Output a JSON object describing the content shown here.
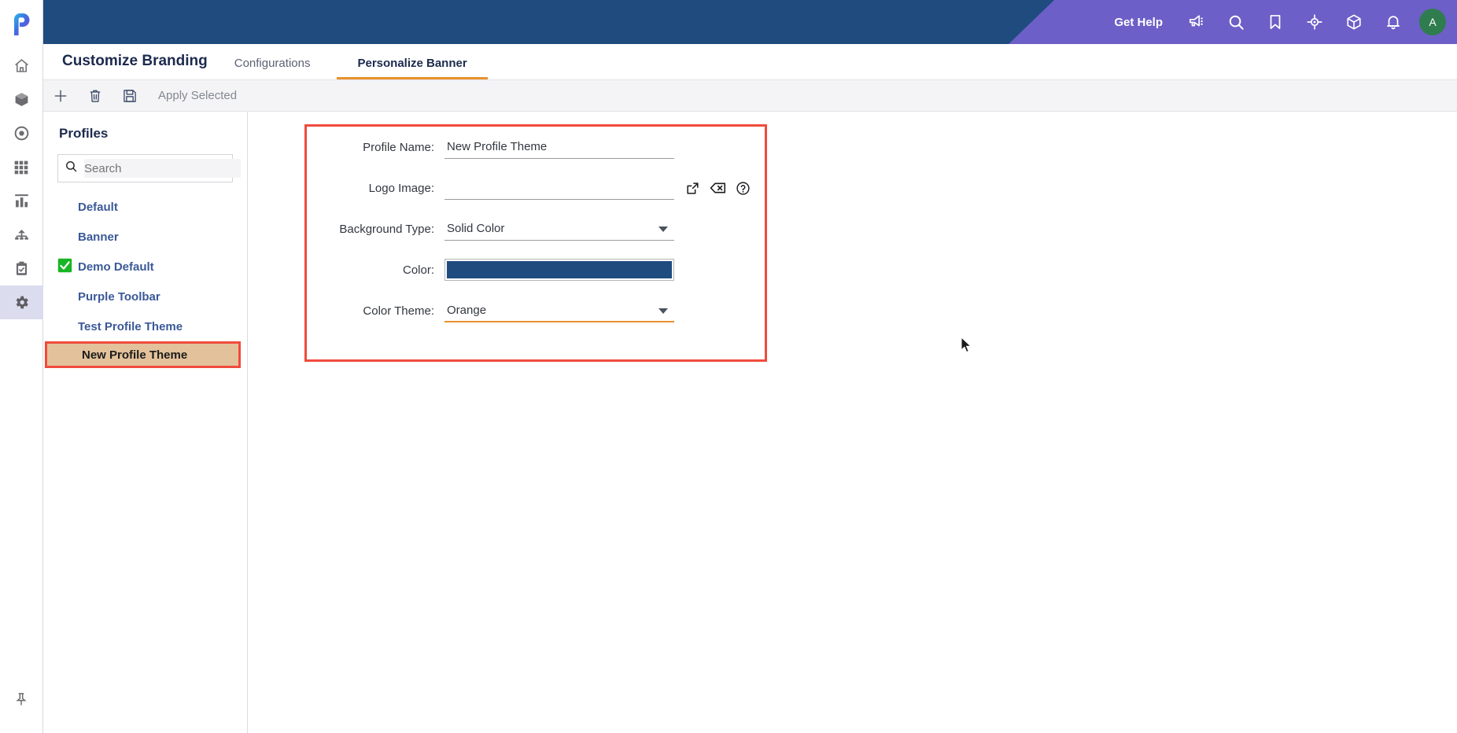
{
  "app": {
    "logo_icon": "p-logo-icon"
  },
  "rail": {
    "items": [
      {
        "icon": "home-icon",
        "name": "home",
        "active": false
      },
      {
        "icon": "cube-icon",
        "name": "assets",
        "active": false
      },
      {
        "icon": "target-icon",
        "name": "targets",
        "active": false
      },
      {
        "icon": "grid-icon",
        "name": "apps",
        "active": false
      },
      {
        "icon": "bar-chart-icon",
        "name": "reports",
        "active": false
      },
      {
        "icon": "hierarchy-icon",
        "name": "hierarchy",
        "active": false
      },
      {
        "icon": "clipboard-check-icon",
        "name": "tasks",
        "active": false
      },
      {
        "icon": "gear-icon",
        "name": "settings",
        "active": true
      }
    ],
    "pin": {
      "icon": "pushpin-icon",
      "name": "pin-sidebar"
    }
  },
  "header": {
    "get_help_label": "Get Help",
    "icons": [
      {
        "icon": "megaphone-icon",
        "name": "announcements"
      },
      {
        "icon": "search-icon",
        "name": "global-search"
      },
      {
        "icon": "bookmark-icon",
        "name": "bookmarks"
      },
      {
        "icon": "compass-icon",
        "name": "navigator"
      },
      {
        "icon": "package-icon",
        "name": "packages"
      },
      {
        "icon": "bell-icon",
        "name": "notifications"
      }
    ],
    "avatar_initial": "A",
    "avatar_color": "#2f7d4f",
    "banner_color": "#1f4b7f",
    "accent_color": "#6c5fc7"
  },
  "titlebar": {
    "title": "Customize Branding",
    "tabs": [
      {
        "label": "Configurations",
        "active": false
      },
      {
        "label": "Personalize Banner",
        "active": true
      }
    ],
    "active_tab_underline": "#e8912d"
  },
  "toolbar": {
    "buttons": [
      {
        "icon": "plus-icon",
        "name": "add-profile"
      },
      {
        "icon": "trash-icon",
        "name": "delete-profile"
      },
      {
        "icon": "save-icon",
        "name": "save-profile"
      }
    ],
    "apply_selected_label": "Apply Selected"
  },
  "profiles": {
    "title": "Profiles",
    "search": {
      "placeholder": "Search",
      "value": "",
      "icon": "search-icon"
    },
    "items": [
      {
        "label": "Default",
        "checked": false,
        "selected": false
      },
      {
        "label": "Banner",
        "checked": false,
        "selected": false
      },
      {
        "label": "Demo Default",
        "checked": true,
        "selected": false
      },
      {
        "label": "Purple Toolbar",
        "checked": false,
        "selected": false
      },
      {
        "label": "Test Profile Theme",
        "checked": false,
        "selected": false
      },
      {
        "label": "New Profile Theme",
        "checked": false,
        "selected": true
      }
    ],
    "checked_color": "#18b524",
    "selected_bg": "#e3c29b",
    "highlight_border": "#f04b3c"
  },
  "form": {
    "highlight_border": "#f04b3c",
    "profile_name": {
      "label": "Profile Name:",
      "value": "New Profile Theme"
    },
    "logo_image": {
      "label": "Logo Image:",
      "value": "",
      "actions": [
        {
          "icon": "external-link-icon",
          "name": "browse-logo"
        },
        {
          "icon": "clear-x-icon",
          "name": "clear-logo"
        },
        {
          "icon": "help-circle-icon",
          "name": "logo-help"
        }
      ]
    },
    "background_type": {
      "label": "Background Type:",
      "value": "Solid Color"
    },
    "color": {
      "label": "Color:",
      "value": "#1f4b7f"
    },
    "color_theme": {
      "label": "Color Theme:",
      "value": "Orange",
      "focused": true,
      "focus_color": "#e8912d"
    }
  }
}
